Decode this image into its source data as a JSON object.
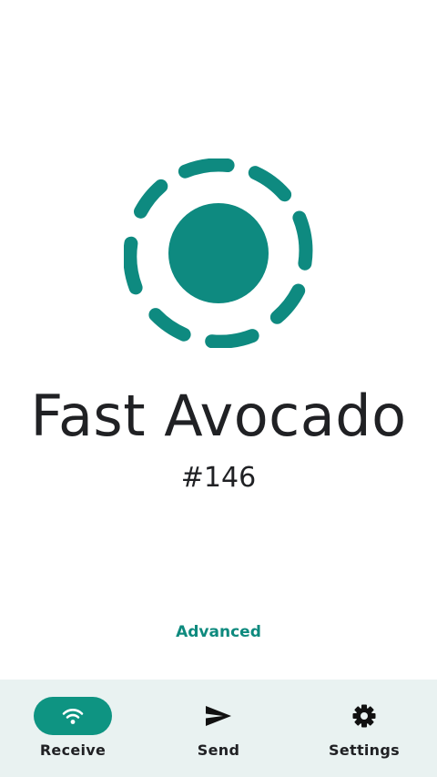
{
  "device": {
    "name": "Fast Avocado",
    "id": "#146",
    "logo_icon": "device-avatar-icon",
    "color": "#0e8a80"
  },
  "advanced": {
    "label": "Advanced",
    "color": "#0e8a7e"
  },
  "bottom_nav": {
    "background": "#e9f2f1",
    "active_color": "#0e9482",
    "items": [
      {
        "label": "Receive",
        "icon": "wifi-icon",
        "active": true
      },
      {
        "label": "Send",
        "icon": "send-icon",
        "active": false
      },
      {
        "label": "Settings",
        "icon": "gear-icon",
        "active": false
      }
    ]
  }
}
